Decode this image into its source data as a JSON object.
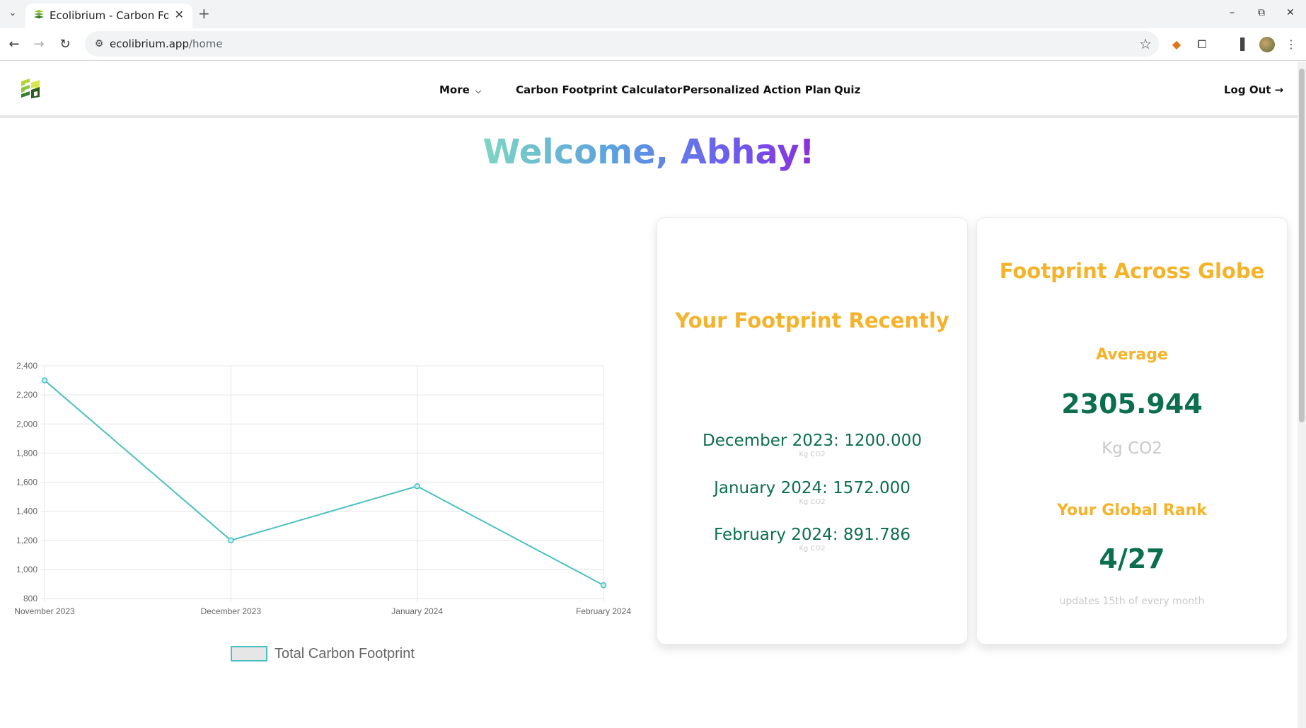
{
  "browser": {
    "tab_title": "Ecolibrium - Carbon Footprint",
    "url_host": "ecolibrium.app",
    "url_path": "/home"
  },
  "nav": {
    "more": "More",
    "calculator": "Carbon Footprint Calculator",
    "action_plan": "Personalized Action Plan",
    "quiz": "Quiz",
    "logout": "Log Out →"
  },
  "welcome": "Welcome, Abhay!",
  "chart_data": {
    "type": "line",
    "categories": [
      "November 2023",
      "December 2023",
      "January 2024",
      "February 2024"
    ],
    "series": [
      {
        "name": "Total Carbon Footprint",
        "values": [
          2300,
          1200,
          1572,
          891.786
        ],
        "color": "#4bc0c0"
      }
    ],
    "ylim": [
      800,
      2400
    ],
    "yticks": [
      "2,400",
      "2,200",
      "2,000",
      "1,800",
      "1,600",
      "1,400",
      "1,200",
      "1,000",
      "800"
    ],
    "grid": true,
    "legend": "bottom"
  },
  "recent": {
    "title": "Your Footprint Recently",
    "items": [
      {
        "label": "December 2023: 1200.000",
        "unit": "Kg CO2"
      },
      {
        "label": "January 2024: 1572.000",
        "unit": "Kg CO2"
      },
      {
        "label": "February 2024: 891.786",
        "unit": "Kg CO2"
      }
    ]
  },
  "globe": {
    "title": "Footprint Across Globe",
    "average_label": "Average",
    "average_value": "2305.944",
    "average_unit": "Kg CO2",
    "rank_label": "Your Global Rank",
    "rank_value": "4/27",
    "note": "updates 15th of every month"
  }
}
